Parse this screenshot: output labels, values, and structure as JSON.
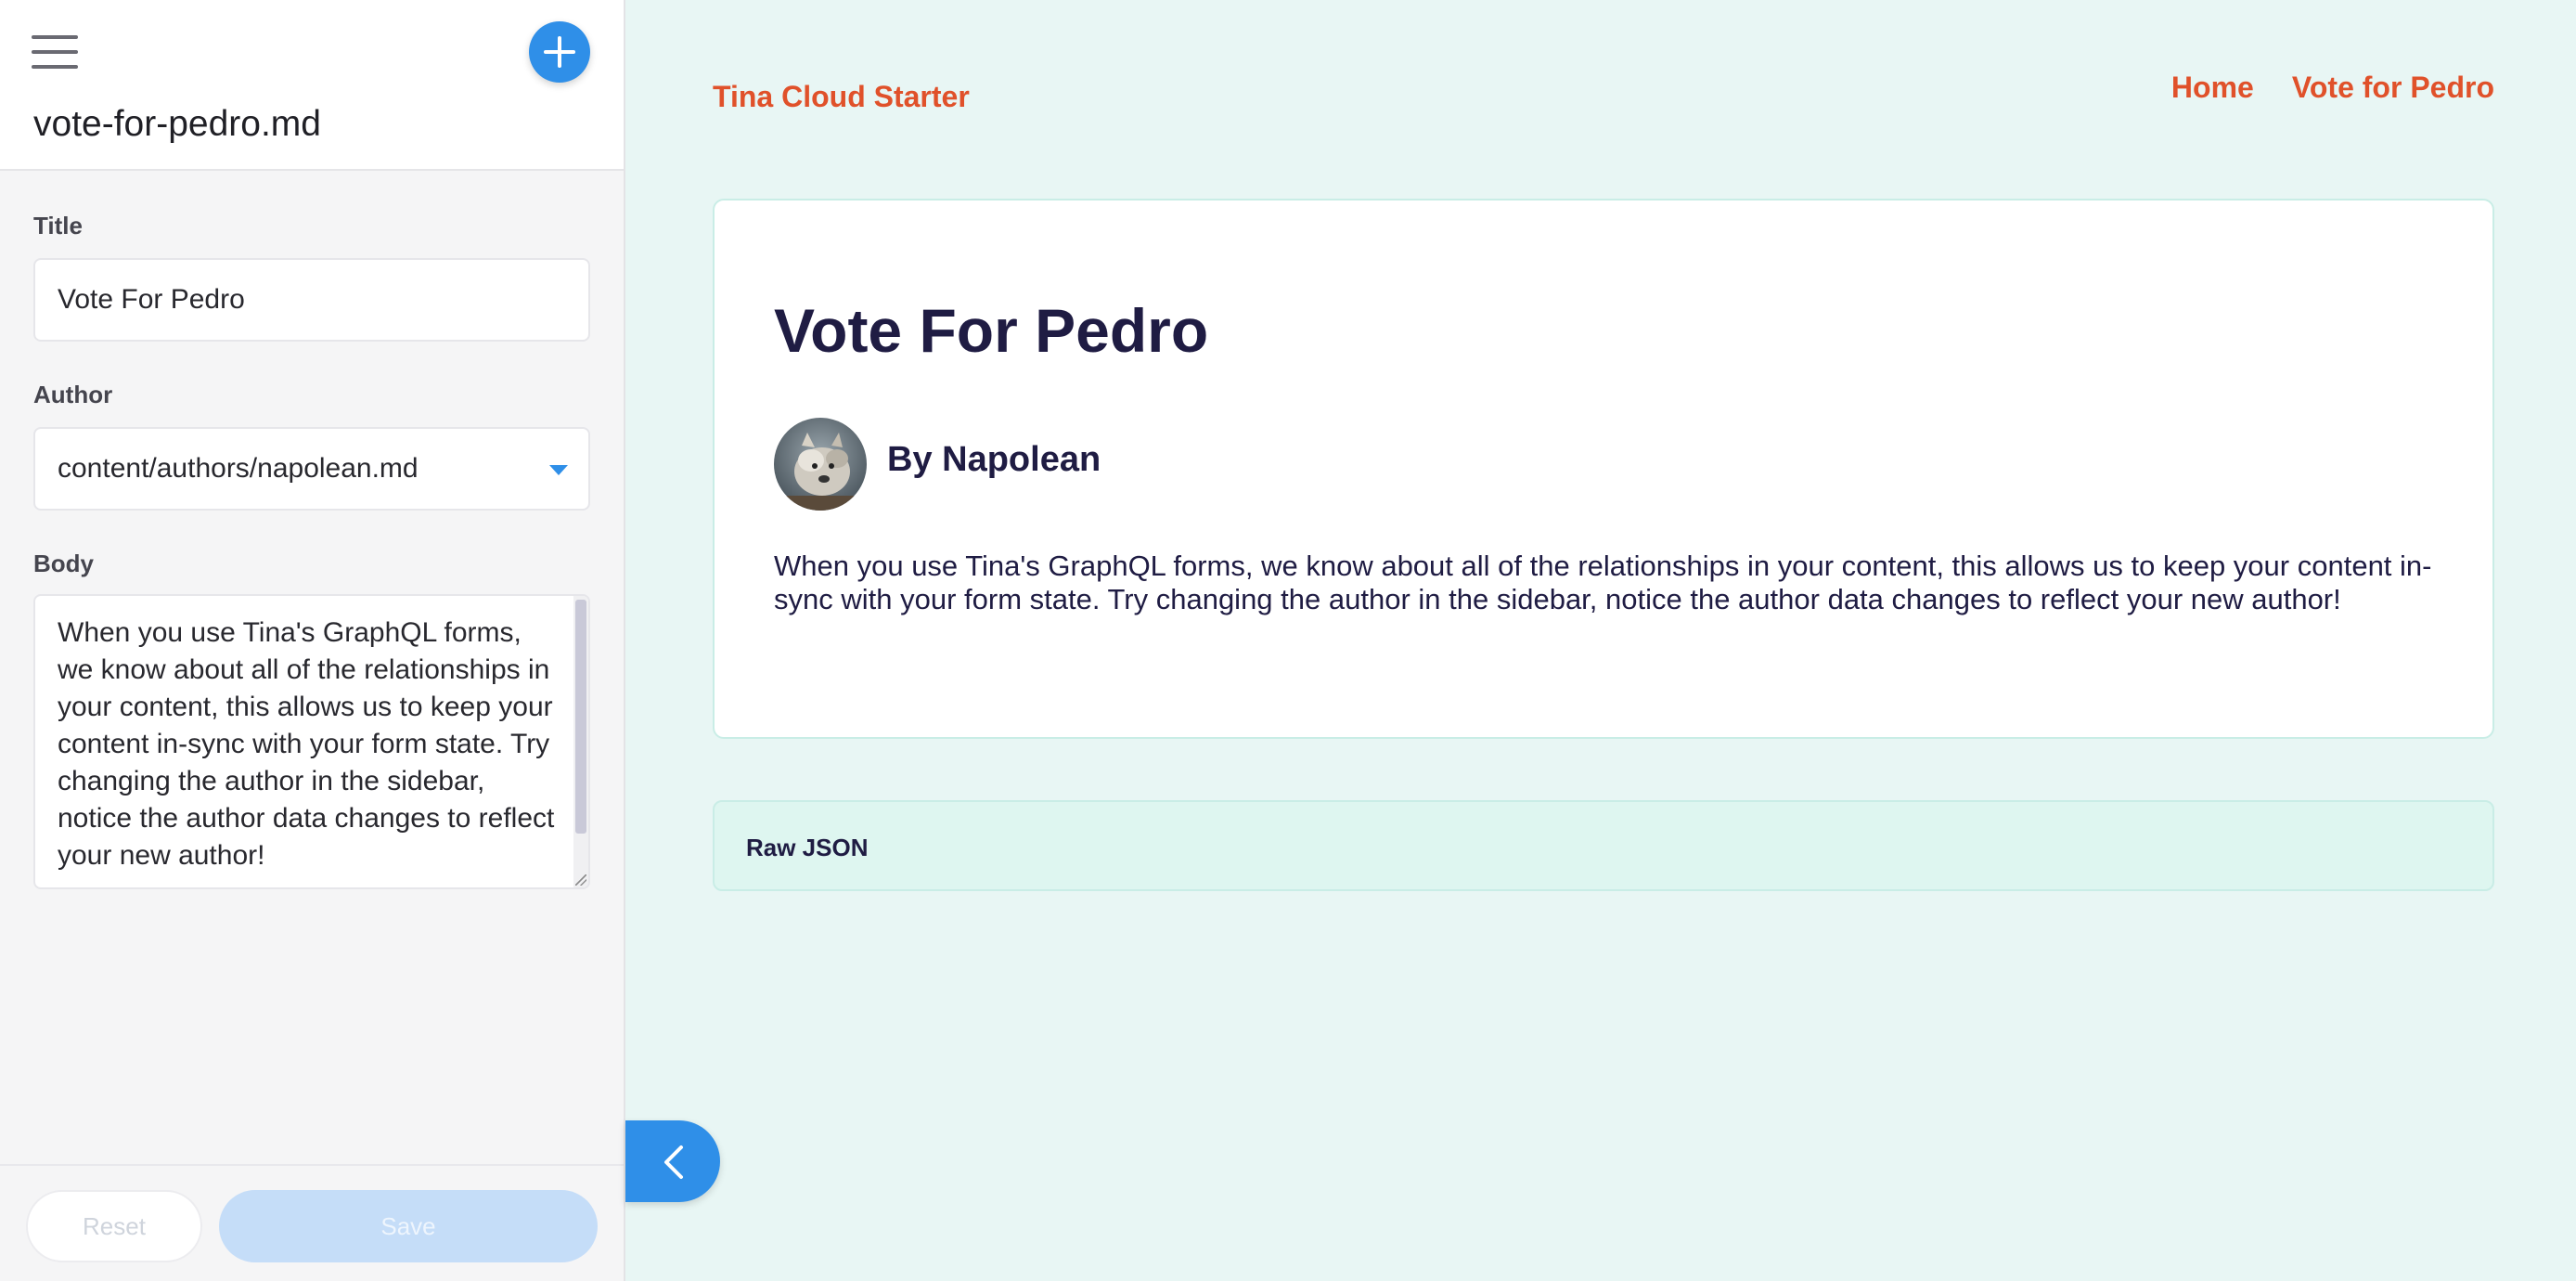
{
  "sidebar": {
    "document_name": "vote-for-pedro.md",
    "fields": {
      "title_label": "Title",
      "title_value": "Vote For Pedro",
      "author_label": "Author",
      "author_value": "content/authors/napolean.md",
      "body_label": "Body",
      "body_value": "When you use Tina's GraphQL forms, we know about all of the relationships in your content, this allows us to keep your content in-sync with your form state. Try changing the author in the sidebar, notice the author data changes to reflect your new author!"
    },
    "footer": {
      "reset_label": "Reset",
      "save_label": "Save"
    }
  },
  "site": {
    "title": "Tina Cloud Starter",
    "nav": [
      "Home",
      "Vote for Pedro"
    ]
  },
  "post": {
    "title": "Vote For Pedro",
    "byline": "By Napolean",
    "body": "When you use Tina's GraphQL forms, we know about all of the relationships in your content, this allows us to keep your content in-sync with your form state. Try changing the author in the sidebar, notice the author data changes to reflect your new author!"
  },
  "raw_json": {
    "label": "Raw JSON"
  },
  "colors": {
    "accent_blue": "#2f8fe8",
    "brand_orange": "#e0512a",
    "heading_navy": "#1f1c43",
    "page_mint": "#e8f6f4"
  }
}
